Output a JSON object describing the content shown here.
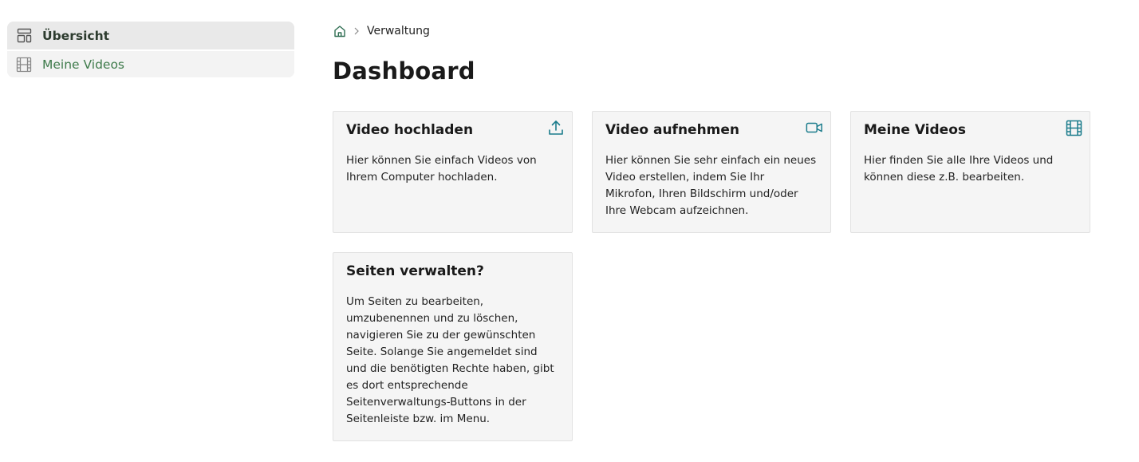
{
  "colors": {
    "accent_teal": "#1b7c8c",
    "nav_green": "#3d7a4a",
    "sidebar_bg": "#eeeeee",
    "card_bg": "#f5f5f5"
  },
  "sidebar": {
    "items": [
      {
        "label": "Übersicht",
        "icon": "layout-icon",
        "active": true
      },
      {
        "label": "Meine Videos",
        "icon": "film-icon",
        "active": false
      }
    ]
  },
  "breadcrumb": {
    "home_icon": "home-icon",
    "separator_icon": "chevron-right-icon",
    "current": "Verwaltung"
  },
  "main": {
    "title": "Dashboard"
  },
  "cards": [
    {
      "title": "Video hochladen",
      "text": "Hier können Sie einfach Videos von Ihrem Computer hochladen.",
      "icon": "upload-icon"
    },
    {
      "title": "Video aufnehmen",
      "text": "Hier können Sie sehr einfach ein neues Video erstellen, indem Sie Ihr Mikrofon, Ihren Bildschirm und/oder Ihre Webcam aufzeichnen.",
      "icon": "video-camera-icon"
    },
    {
      "title": "Meine Videos",
      "text": "Hier finden Sie alle Ihre Videos und können diese z.B. bearbeiten.",
      "icon": "film-icon"
    },
    {
      "title": "Seiten verwalten?",
      "text": "Um Seiten zu bearbeiten, umzubenennen und zu löschen, navigieren Sie zu der gewünschten Seite. Solange Sie angemeldet sind und die benötigten Rechte haben, gibt es dort entsprechende Seitenverwaltungs-Buttons in der Seitenleiste bzw. im Menu."
    }
  ]
}
